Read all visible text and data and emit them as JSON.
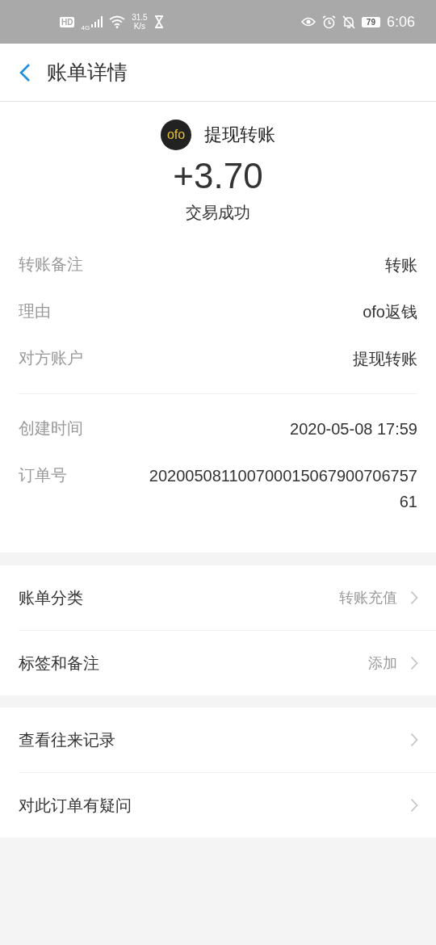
{
  "status_bar": {
    "hd": "HD",
    "network": "4G",
    "speed": "31.5",
    "speed_unit": "K/s",
    "battery": "79",
    "time": "6:06"
  },
  "nav": {
    "title": "账单详情"
  },
  "summary": {
    "logo": "ofo",
    "name": "提现转账",
    "amount": "+3.70",
    "status": "交易成功"
  },
  "detail_groups": [
    [
      {
        "label": "转账备注",
        "value": "转账"
      },
      {
        "label": "理由",
        "value": "ofo返钱"
      },
      {
        "label": "对方账户",
        "value": "提现转账"
      }
    ],
    [
      {
        "label": "创建时间",
        "value": "2020-05-08 17:59"
      },
      {
        "label": "订单号",
        "value": "20200508110070001506790070675761"
      }
    ]
  ],
  "menu_groups": [
    [
      {
        "label": "账单分类",
        "value": "转账充值"
      },
      {
        "label": "标签和备注",
        "value": "添加"
      }
    ],
    [
      {
        "label": "查看往来记录"
      },
      {
        "label": "对此订单有疑问"
      }
    ]
  ]
}
